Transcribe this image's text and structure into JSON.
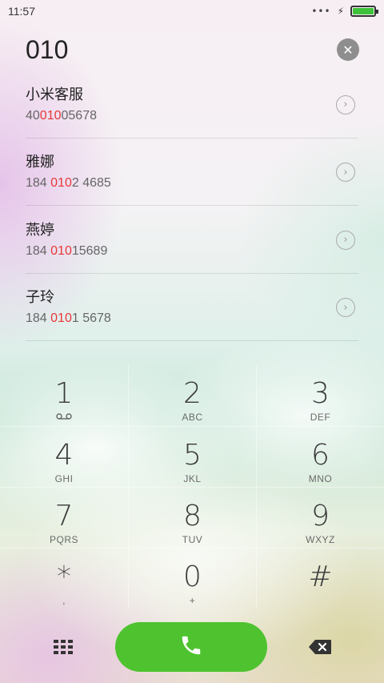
{
  "status_bar": {
    "time": "11:57",
    "signal_dots": "•••",
    "charging_icon": "charging-bolt-icon",
    "battery_level": 1.0,
    "battery_color": "#3ec23b"
  },
  "dial_entry": {
    "number": "010",
    "clear_icon": "clear-x-icon"
  },
  "results": [
    {
      "name": "小米客服",
      "number_prefix": "40",
      "number_match": "010",
      "number_suffix": "05678"
    },
    {
      "name": "雅娜",
      "number_prefix": "184 ",
      "number_match": "010",
      "number_suffix": "2 4685"
    },
    {
      "name": "燕婷",
      "number_prefix": "184 ",
      "number_match": "010",
      "number_suffix": "15689"
    },
    {
      "name": "子玲",
      "number_prefix": "184 ",
      "number_match": "010",
      "number_suffix": "1 5678"
    }
  ],
  "keypad": {
    "keys": [
      {
        "digit": "1",
        "letters": "",
        "sub_icon": "voicemail-icon"
      },
      {
        "digit": "2",
        "letters": "ABC"
      },
      {
        "digit": "3",
        "letters": "DEF"
      },
      {
        "digit": "4",
        "letters": "GHI"
      },
      {
        "digit": "5",
        "letters": "JKL"
      },
      {
        "digit": "6",
        "letters": "MNO"
      },
      {
        "digit": "7",
        "letters": "PQRS"
      },
      {
        "digit": "8",
        "letters": "TUV"
      },
      {
        "digit": "9",
        "letters": "WXYZ"
      },
      {
        "digit": "*",
        "letters": ","
      },
      {
        "digit": "0",
        "letters": "+"
      },
      {
        "digit": "#",
        "letters": ""
      }
    ]
  },
  "bottom_bar": {
    "dialpad_icon": "dialpad-grid-icon",
    "call_icon": "phone-icon",
    "delete_icon": "backspace-icon",
    "call_color": "#4ec32f"
  },
  "colors": {
    "match_highlight": "#e8383a"
  }
}
